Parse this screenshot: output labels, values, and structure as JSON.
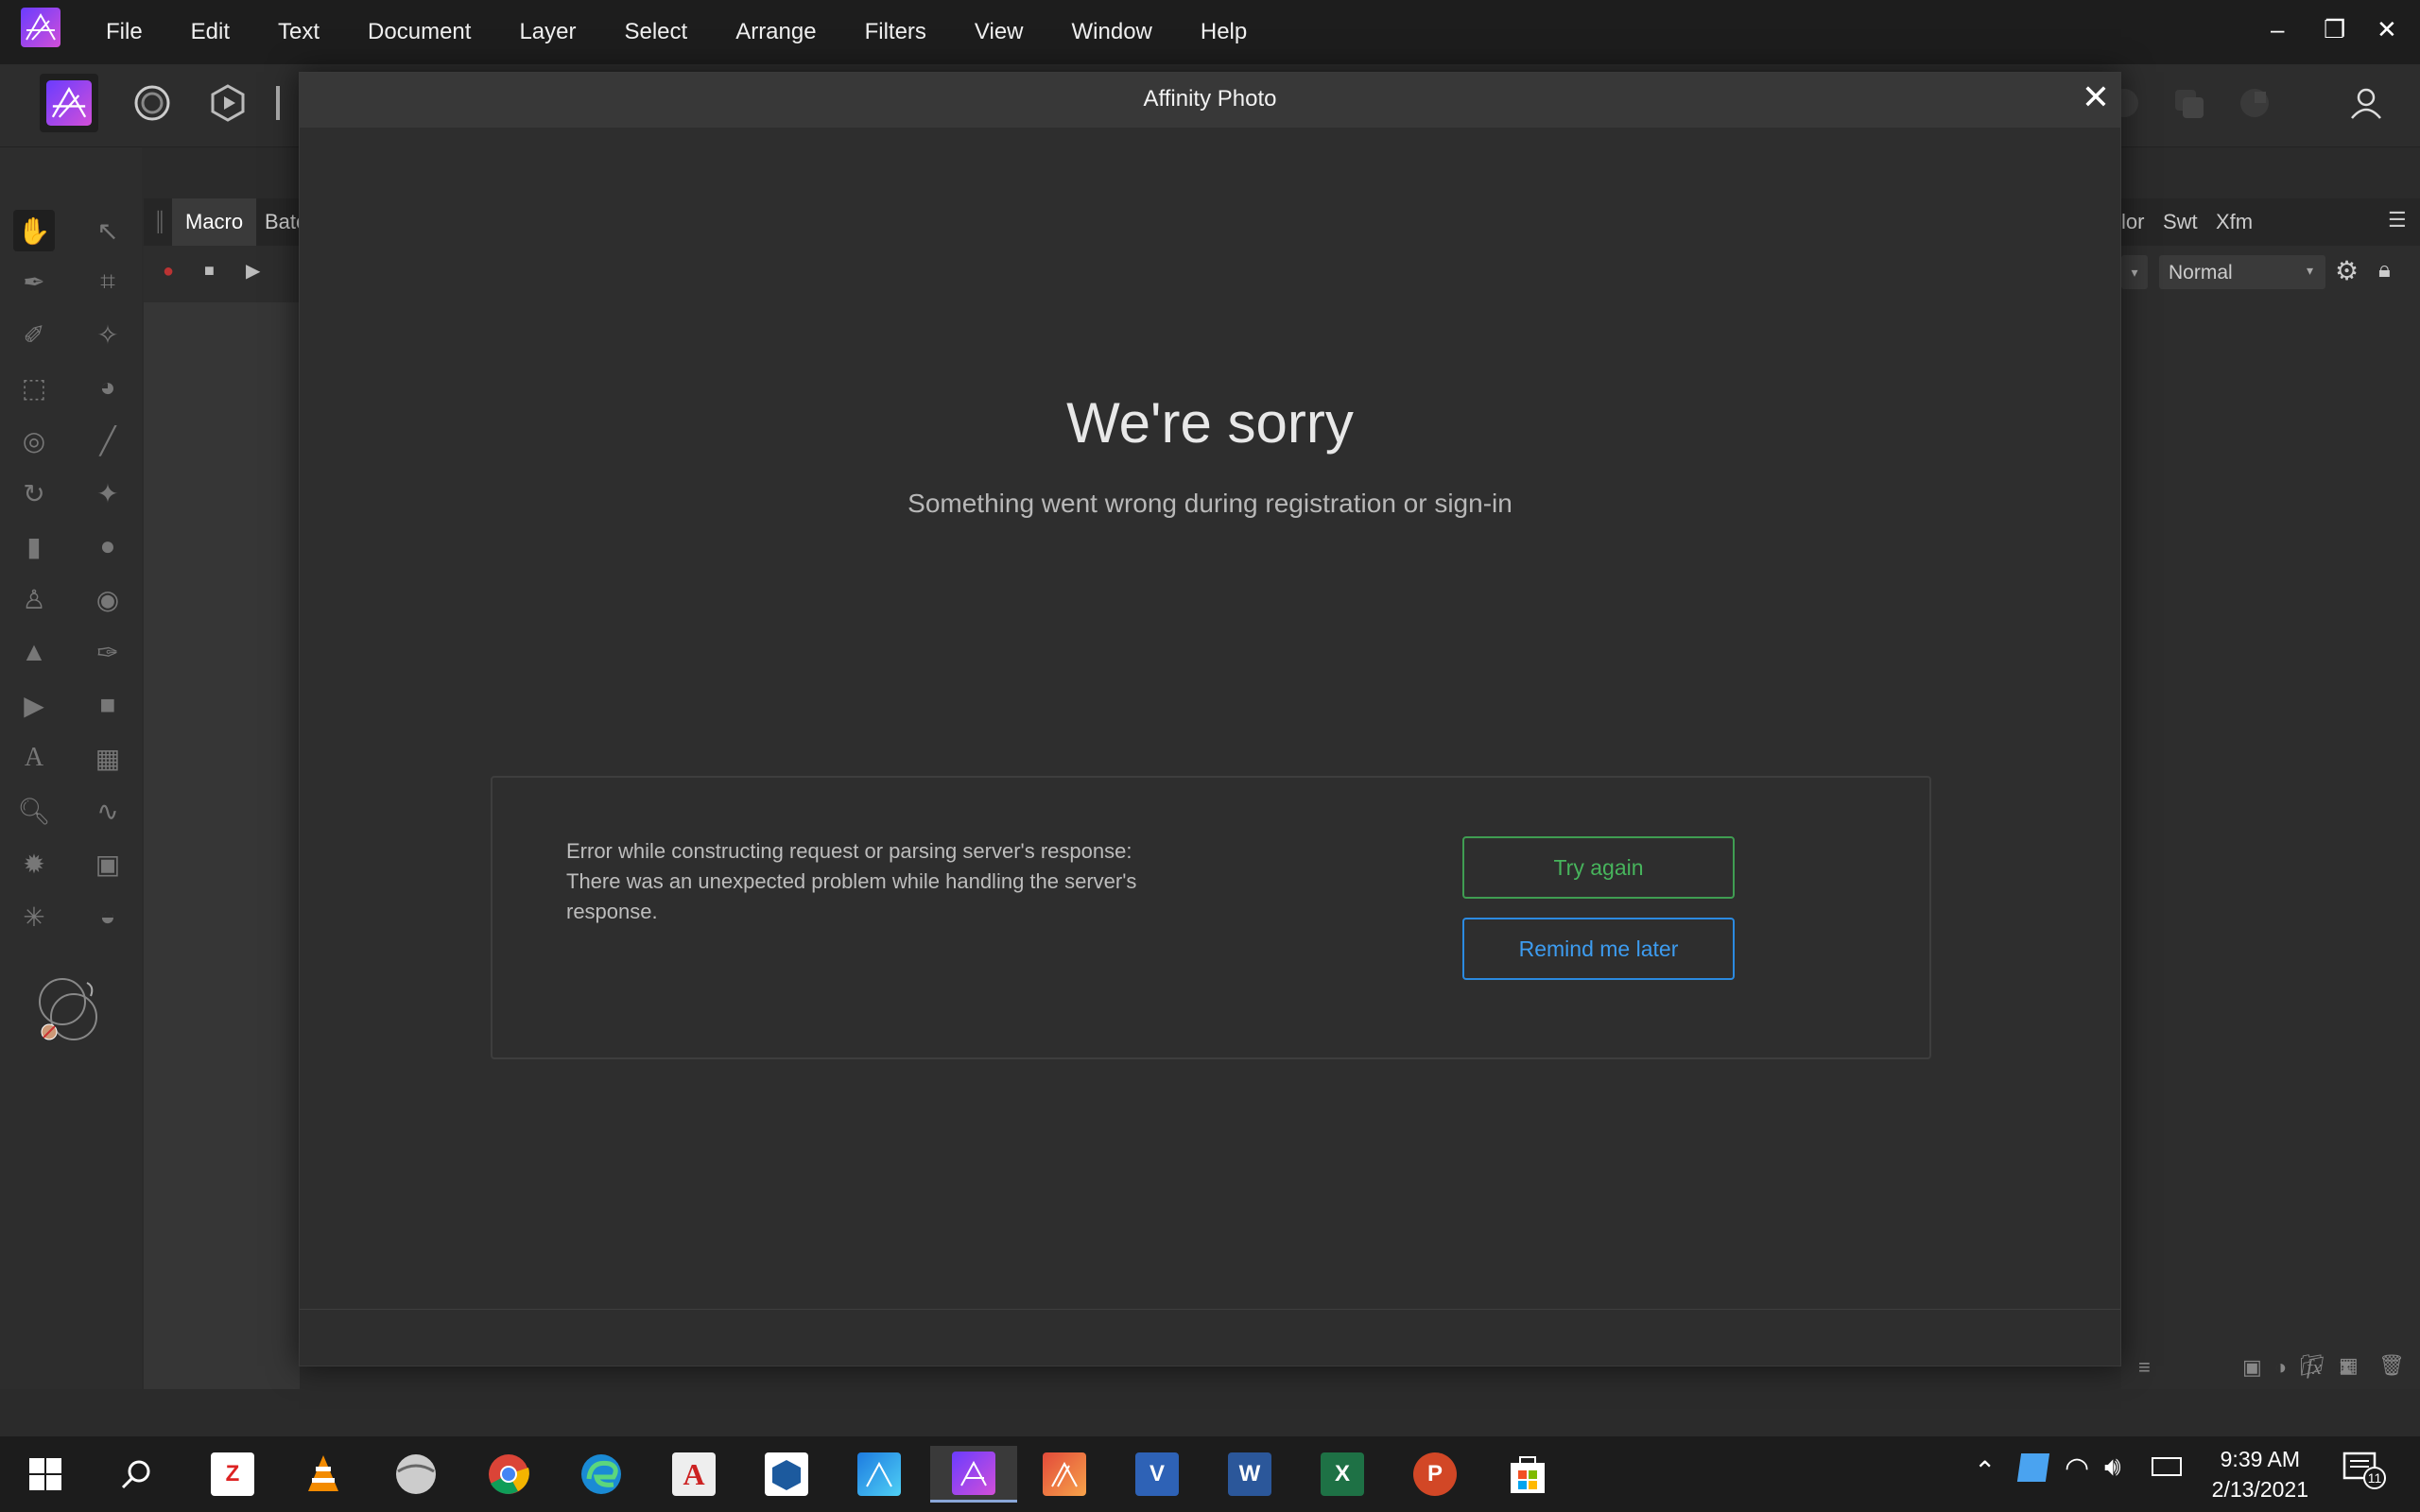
{
  "menubar": {
    "items": [
      "File",
      "Edit",
      "Text",
      "Document",
      "Layer",
      "Select",
      "Arrange",
      "Filters",
      "View",
      "Window",
      "Help"
    ]
  },
  "panels": {
    "left_tabs": [
      "Macro",
      "Batc"
    ],
    "right_tabs": [
      "lor",
      "Swt",
      "Xfm"
    ],
    "blend_mode": "Normal"
  },
  "dialog": {
    "title": "Affinity Photo",
    "heading": "We're sorry",
    "subtitle": "Something went wrong during registration or sign-in",
    "error_line1": "Error while constructing request or parsing server's response:",
    "error_line2": "There was an unexpected problem while handling the server's",
    "error_line3": "response.",
    "try_again": "Try again",
    "remind_later": "Remind me later"
  },
  "taskbar": {
    "time": "9:39 AM",
    "date": "2/13/2021",
    "notifications": "11"
  },
  "colors": {
    "accent_green": "#47b45c",
    "accent_blue": "#3d9cf0",
    "affinity_purple": "#b04ee0"
  }
}
